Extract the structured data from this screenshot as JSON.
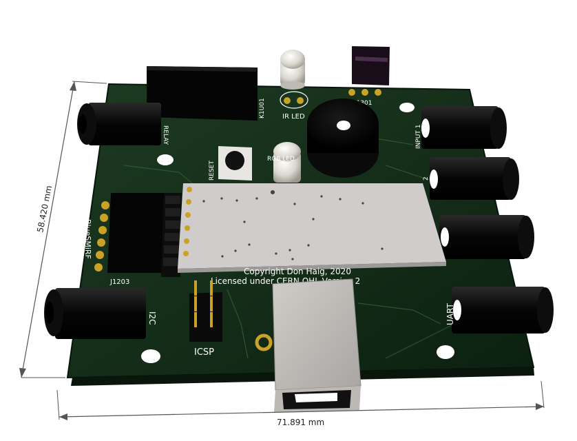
{
  "board": {
    "silkscreen": {
      "relay": "RELAY",
      "k1u01": "K1U01",
      "ir_led": "IR LED",
      "rgb_led": "RGB LED",
      "u1301": "U1301",
      "reset": "RESET",
      "input1": "INPUT 1",
      "input2": "2",
      "bluesmirf": "BlueSMiRF",
      "j1203": "J1203",
      "i2c": "I2C",
      "icsp": "ICSP",
      "uart": "UART",
      "copyright": "Copyright Don Haig, 2020",
      "license": "Licensed under CERN OHL Version 2"
    }
  },
  "dimensions": {
    "width": "71.891 mm",
    "height": "58.420 mm"
  },
  "colors": {
    "pcb": "#0f2a14",
    "copper_pad": "#c9a227",
    "silk": "#ffffff",
    "component_body": "#0b0b0b"
  }
}
